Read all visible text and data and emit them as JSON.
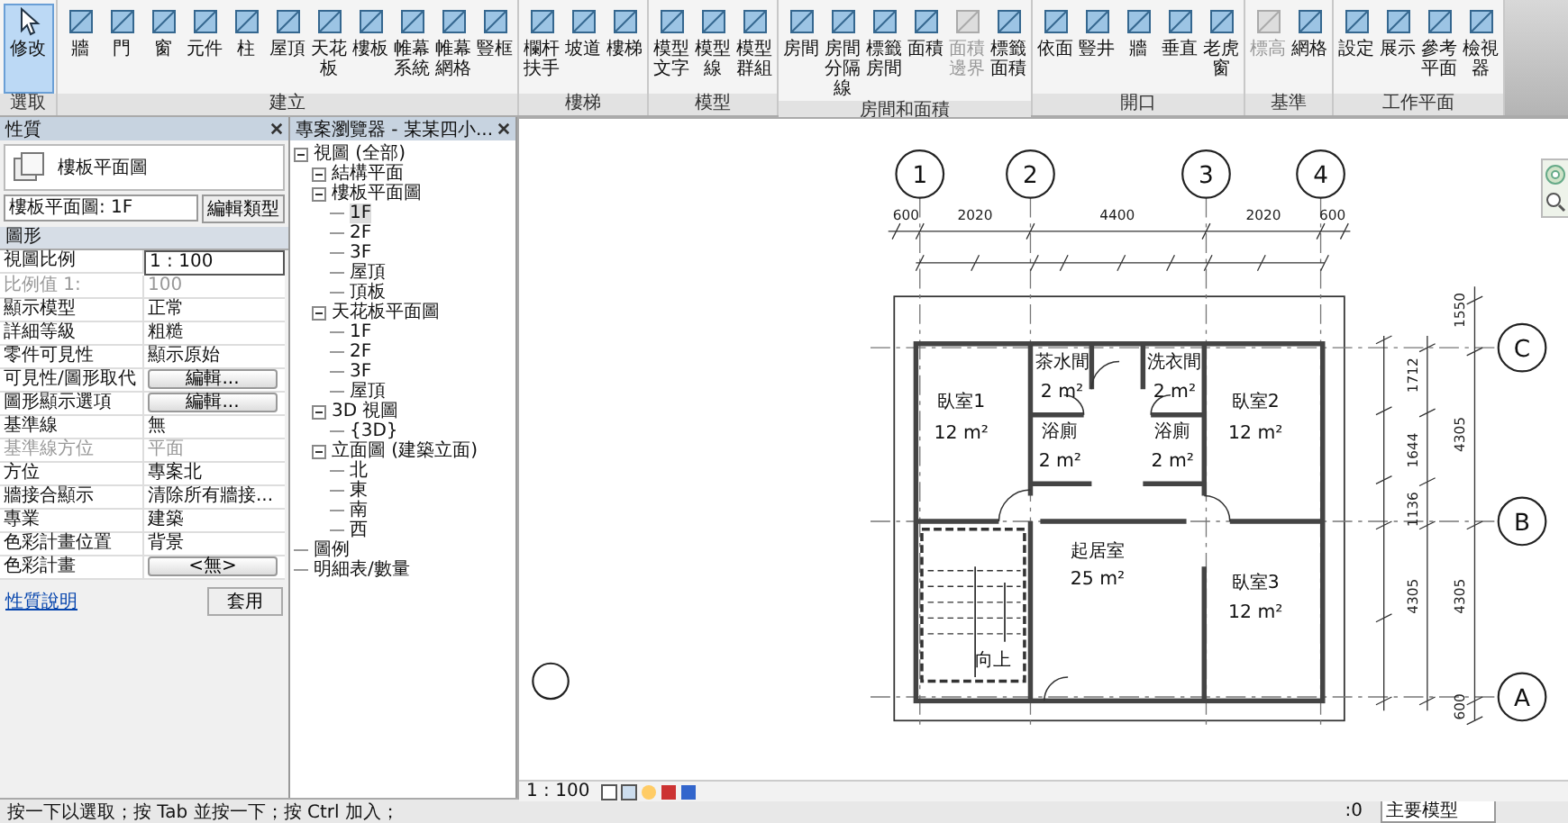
{
  "ribbon": {
    "panels": [
      {
        "label": "選取",
        "tools": [
          {
            "label": "修改",
            "selected": true,
            "disabled": false
          }
        ]
      },
      {
        "label": "建立",
        "tools": [
          {
            "label": "牆",
            "selected": false,
            "disabled": false
          },
          {
            "label": "門",
            "selected": false,
            "disabled": false
          },
          {
            "label": "窗",
            "selected": false,
            "disabled": false
          },
          {
            "label": "元件",
            "selected": false,
            "disabled": false
          },
          {
            "label": "柱",
            "selected": false,
            "disabled": false
          },
          {
            "label": "屋頂",
            "selected": false,
            "disabled": false
          },
          {
            "label": "天花板",
            "selected": false,
            "disabled": false
          },
          {
            "label": "樓板",
            "selected": false,
            "disabled": false
          },
          {
            "label": "帷幕系統",
            "selected": false,
            "disabled": false
          },
          {
            "label": "帷幕網格",
            "selected": false,
            "disabled": false
          },
          {
            "label": "豎框",
            "selected": false,
            "disabled": false
          }
        ]
      },
      {
        "label": "樓梯",
        "tools": [
          {
            "label": "欄杆扶手",
            "selected": false,
            "disabled": false
          },
          {
            "label": "坡道",
            "selected": false,
            "disabled": false
          },
          {
            "label": "樓梯",
            "selected": false,
            "disabled": false
          }
        ]
      },
      {
        "label": "模型",
        "tools": [
          {
            "label": "模型文字",
            "selected": false,
            "disabled": false
          },
          {
            "label": "模型線",
            "selected": false,
            "disabled": false
          },
          {
            "label": "模型群組",
            "selected": false,
            "disabled": false
          }
        ]
      },
      {
        "label": "房間和面積",
        "tools": [
          {
            "label": "房間",
            "selected": false,
            "disabled": false
          },
          {
            "label": "房間分隔線",
            "selected": false,
            "disabled": false
          },
          {
            "label": "標籤房間",
            "selected": false,
            "disabled": false
          },
          {
            "label": "面積",
            "selected": false,
            "disabled": false
          },
          {
            "label": "面積邊界",
            "selected": false,
            "disabled": true
          },
          {
            "label": "標籤面積",
            "selected": false,
            "disabled": false
          }
        ]
      },
      {
        "label": "開口",
        "tools": [
          {
            "label": "依面",
            "selected": false,
            "disabled": false
          },
          {
            "label": "豎井",
            "selected": false,
            "disabled": false
          },
          {
            "label": "牆",
            "selected": false,
            "disabled": false
          },
          {
            "label": "垂直",
            "selected": false,
            "disabled": false
          },
          {
            "label": "老虎窗",
            "selected": false,
            "disabled": false
          }
        ]
      },
      {
        "label": "基準",
        "tools": [
          {
            "label": "標高",
            "selected": false,
            "disabled": true
          },
          {
            "label": "網格",
            "selected": false,
            "disabled": false
          }
        ]
      },
      {
        "label": "工作平面",
        "tools": [
          {
            "label": "設定",
            "selected": false,
            "disabled": false
          },
          {
            "label": "展示",
            "selected": false,
            "disabled": false
          },
          {
            "label": "參考平面",
            "selected": false,
            "disabled": false
          },
          {
            "label": "檢視器",
            "selected": false,
            "disabled": false
          }
        ]
      }
    ]
  },
  "properties": {
    "title": "性質",
    "type_name": "樓板平面圖",
    "view_selector": "樓板平面圖: 1F",
    "edit_type": "編輯類型",
    "group": "圖形",
    "rows": [
      {
        "name": "視圖比例",
        "value": "1 : 100",
        "kind": "input",
        "disabled": false
      },
      {
        "name": "比例值 1:",
        "value": "100",
        "kind": "text",
        "disabled": true
      },
      {
        "name": "顯示模型",
        "value": "正常",
        "kind": "text",
        "disabled": false
      },
      {
        "name": "詳細等級",
        "value": "粗糙",
        "kind": "text",
        "disabled": false
      },
      {
        "name": "零件可見性",
        "value": "顯示原始",
        "kind": "text",
        "disabled": false
      },
      {
        "name": "可見性/圖形取代",
        "value": "編輯...",
        "kind": "button",
        "disabled": false
      },
      {
        "name": "圖形顯示選項",
        "value": "編輯...",
        "kind": "button",
        "disabled": false
      },
      {
        "name": "基準線",
        "value": "無",
        "kind": "text",
        "disabled": false
      },
      {
        "name": "基準線方位",
        "value": "平面",
        "kind": "text",
        "disabled": true
      },
      {
        "name": "方位",
        "value": "專案北",
        "kind": "text",
        "disabled": false
      },
      {
        "name": "牆接合顯示",
        "value": "清除所有牆接...",
        "kind": "text",
        "disabled": false
      },
      {
        "name": "專業",
        "value": "建築",
        "kind": "text",
        "disabled": false
      },
      {
        "name": "色彩計畫位置",
        "value": "背景",
        "kind": "text",
        "disabled": false
      },
      {
        "name": "色彩計畫",
        "value": "<無>",
        "kind": "button",
        "disabled": false
      }
    ],
    "help_link": "性質說明",
    "apply": "套用"
  },
  "project_browser": {
    "title": "專案瀏覽器 - 某某四小...",
    "tree": [
      {
        "label": "視圖 (全部)",
        "selected": false,
        "expanded": true,
        "children": [
          {
            "label": "結構平面",
            "selected": false,
            "expanded": true
          },
          {
            "label": "樓板平面圖",
            "selected": false,
            "expanded": true,
            "children": [
              {
                "label": "1F",
                "selected": true
              },
              {
                "label": "2F",
                "selected": false
              },
              {
                "label": "3F",
                "selected": false
              },
              {
                "label": "屋頂",
                "selected": false
              },
              {
                "label": "頂板",
                "selected": false
              }
            ]
          },
          {
            "label": "天花板平面圖",
            "selected": false,
            "expanded": true,
            "children": [
              {
                "label": "1F",
                "selected": false
              },
              {
                "label": "2F",
                "selected": false
              },
              {
                "label": "3F",
                "selected": false
              },
              {
                "label": "屋頂",
                "selected": false
              }
            ]
          },
          {
            "label": "3D 視圖",
            "selected": false,
            "expanded": true,
            "children": [
              {
                "label": "{3D}",
                "selected": false
              }
            ]
          },
          {
            "label": "立面圖 (建築立面)",
            "selected": false,
            "expanded": true,
            "children": [
              {
                "label": "北",
                "selected": false
              },
              {
                "label": "東",
                "selected": false
              },
              {
                "label": "南",
                "selected": false
              },
              {
                "label": "西",
                "selected": false
              }
            ]
          }
        ]
      },
      {
        "label": "圖例",
        "selected": false
      },
      {
        "label": "明細表/數量",
        "selected": false
      }
    ]
  },
  "plan": {
    "grids": [
      "1",
      "2",
      "3",
      "4",
      "C",
      "B",
      "A"
    ],
    "rooms": [
      {
        "name": "臥室1",
        "area": "12 m²"
      },
      {
        "name": "茶水間",
        "area": "2 m²"
      },
      {
        "name": "浴廁",
        "area": "2 m²"
      },
      {
        "name": "洗衣間",
        "area": "2 m²"
      },
      {
        "name": "浴廁",
        "area": "2 m²"
      },
      {
        "name": "臥室2",
        "area": "12 m²"
      },
      {
        "name": "起居室",
        "area": "25 m²"
      },
      {
        "name": "臥室3",
        "area": "12 m²"
      }
    ],
    "stair_label": "向上",
    "top_dimensions": [
      "600",
      "2020",
      "4400",
      "2020",
      "600"
    ],
    "right_dimensions_inner": [
      "1712",
      "1644",
      "1136",
      "4305"
    ],
    "right_dimensions_outer": [
      "1550",
      "4305",
      "4305",
      "600"
    ]
  },
  "view_bar": {
    "scale": "1 : 100"
  },
  "status_bar": {
    "message": "按一下以選取；按 Tab 並按一下；按 Ctrl 加入；",
    "model": "主要模型",
    "count": ":0"
  }
}
